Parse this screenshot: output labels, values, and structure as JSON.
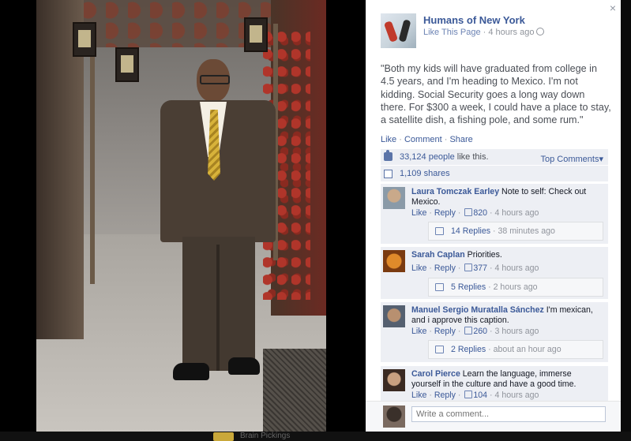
{
  "window": {
    "close_label": "×"
  },
  "page": {
    "name": "Humans of New York",
    "like_link": "Like This Page",
    "separator": " · ",
    "time": "4 hours ago"
  },
  "post": {
    "caption": "\"Both my kids will have graduated from college in 4.5 years, and I'm heading to Mexico. I'm not kidding. Social Security goes a long way down there. For $300 a week, I could have a place to stay, a satellite dish, a fishing pole, and some rum.\"",
    "actions": {
      "like": "Like",
      "comment": "Comment",
      "share": "Share",
      "dot": " · "
    },
    "likes": {
      "count": "33,124 people",
      "suffix": " like this."
    },
    "top_comments_label": "Top Comments▾",
    "shares": "1,109 shares"
  },
  "comments": [
    {
      "name": "Laura Tomczak Earley",
      "text": " Note to self: Check out Mexico.",
      "like": "Like",
      "reply": "Reply",
      "likes": "820",
      "time": "4 hours ago",
      "replies": {
        "count": "14 Replies",
        "time": "38 minutes ago"
      }
    },
    {
      "name": "Sarah Caplan",
      "text": " Priorities.",
      "like": "Like",
      "reply": "Reply",
      "likes": "377",
      "time": "4 hours ago",
      "replies": {
        "count": "5 Replies",
        "time": "2 hours ago"
      }
    },
    {
      "name": "Manuel Sergio Muratalla Sánchez",
      "text": " I'm mexican, and i approve this caption.",
      "like": "Like",
      "reply": "Reply",
      "likes": "260",
      "time": "3 hours ago",
      "replies": {
        "count": "2 Replies",
        "time": "about an hour ago"
      }
    },
    {
      "name": "Carol Pierce",
      "text": " Learn the language, immerse yourself in the culture and have a good time.",
      "like": "Like",
      "reply": "Reply",
      "likes": "104",
      "time": "4 hours ago"
    }
  ],
  "composer": {
    "placeholder": "Write a comment..."
  },
  "bottom_bar": {
    "label": "Brain Pickings"
  }
}
